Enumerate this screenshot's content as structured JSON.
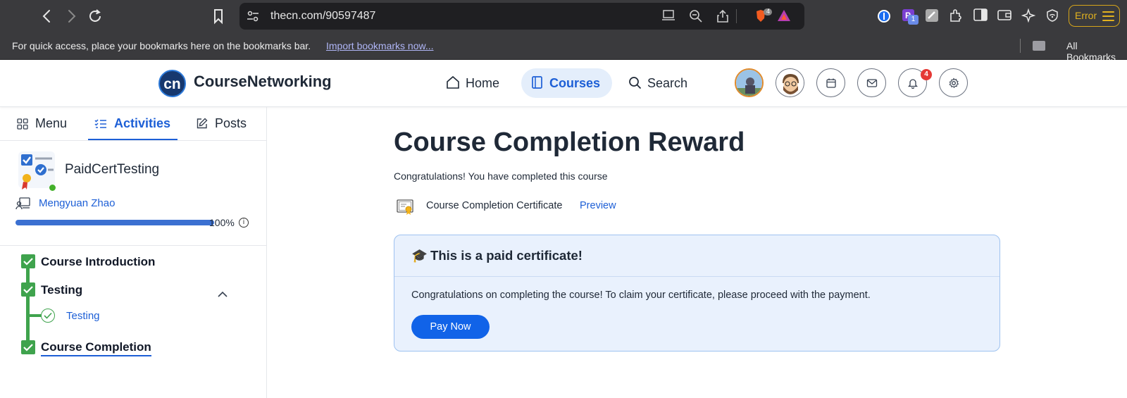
{
  "browser": {
    "url": "thecn.com/90597487",
    "brave_count": "4",
    "ext_p_count": "1",
    "error_label": "Error",
    "bookmarks_prompt": "For quick access, place your bookmarks here on the bookmarks bar.",
    "import_link": "Import bookmarks now...",
    "all_bookmarks": "All Bookmarks"
  },
  "header": {
    "logo_mark": "cn",
    "brand": "CourseNetworking",
    "nav": [
      {
        "label": "Home",
        "icon": "home-icon"
      },
      {
        "label": "Courses",
        "icon": "book-icon",
        "active": true
      },
      {
        "label": "Search",
        "icon": "search-icon"
      }
    ],
    "notification_count": "4"
  },
  "sidebar": {
    "tabs": [
      {
        "label": "Menu",
        "icon": "grid-icon"
      },
      {
        "label": "Activities",
        "icon": "checklist-icon",
        "active": true
      },
      {
        "label": "Posts",
        "icon": "edit-icon"
      }
    ],
    "course_title": "PaidCertTesting",
    "instructor": "Mengyuan Zhao",
    "progress": 100,
    "progress_label": "100%",
    "info_glyph": "i",
    "tree": [
      {
        "label": "Course Introduction",
        "completed": true
      },
      {
        "label": "Testing",
        "completed": true,
        "expanded": true,
        "children": [
          {
            "label": "Testing",
            "completed": true
          }
        ]
      },
      {
        "label": "Course Completion",
        "completed": true,
        "selected": true
      }
    ]
  },
  "main": {
    "title": "Course Completion Reward",
    "congrats": "Congratulations! You have completed this course",
    "certificate_name": "Course Completion Certificate",
    "preview_label": "Preview",
    "paid_card": {
      "icon": "🎓",
      "heading": "This is a paid certificate!",
      "body": "Congratulations on completing the course! To claim your certificate, please proceed with the payment.",
      "button": "Pay Now"
    }
  },
  "colors": {
    "accent": "#1d5fd6",
    "success": "#3fa34d",
    "card_bg": "#e9f1fd",
    "error": "#e2b21f"
  }
}
